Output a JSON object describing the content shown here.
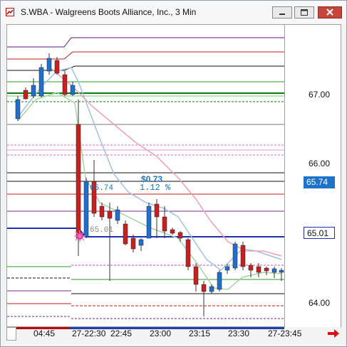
{
  "window": {
    "title": "S.WBA - Walgreens Boots Alliance, Inc., 3 Min",
    "buttons": {
      "minimize": "minimize",
      "maximize": "maximize",
      "close": "close"
    }
  },
  "price_axis": {
    "ticks": [
      "67.00",
      "66.00",
      "64.00"
    ],
    "tags": [
      {
        "label": "65.74",
        "bg": "#1e73c8",
        "fg": "#ffffff"
      },
      {
        "label": "65.01",
        "bg": "#ffffff",
        "fg": "#111111"
      }
    ]
  },
  "time_axis": {
    "labels": [
      "04:45",
      "27-22:30",
      "22:45",
      "23:00",
      "23:15",
      "23:30",
      "27-23:45"
    ]
  },
  "annotations": {
    "move_amount": "$0.73",
    "move_percent": "1.12 %",
    "level_high": "65.74",
    "level_low": "65.01"
  },
  "colors": {
    "up_candle": "#1f6fcf",
    "down_candle": "#c91f1f",
    "accent_blue": "#1e73c8",
    "close_button": "#c7463b"
  },
  "icons": {
    "app": "chart-window-icon",
    "next": "red-arrow-right-icon"
  }
}
